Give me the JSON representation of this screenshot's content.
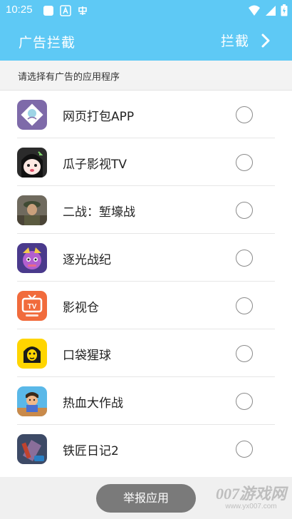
{
  "status_bar": {
    "time": "10:25",
    "background": "#5ec9f5"
  },
  "app_bar": {
    "title": "广告拦截",
    "action_label": "拦截",
    "action_icon": "chevron-right-icon"
  },
  "section": {
    "header": "请选择有广告的应用程序"
  },
  "apps": [
    {
      "name": "网页打包APP",
      "icon": "app-icon-webpack",
      "selected": false
    },
    {
      "name": "瓜子影视TV",
      "icon": "app-icon-guazi",
      "selected": false
    },
    {
      "name": "二战：堑壕战",
      "icon": "app-icon-ww2",
      "selected": false
    },
    {
      "name": "逐光战纪",
      "icon": "app-icon-zhuguang",
      "selected": false
    },
    {
      "name": "影视仓",
      "icon": "app-icon-yingshicang",
      "selected": false
    },
    {
      "name": "口袋猩球",
      "icon": "app-icon-koudai",
      "selected": false
    },
    {
      "name": "热血大作战",
      "icon": "app-icon-rexue",
      "selected": false
    },
    {
      "name": "铁匠日记2",
      "icon": "app-icon-tiejiang",
      "selected": false
    }
  ],
  "bottom": {
    "report_label": "举报应用"
  },
  "watermark": {
    "main": "007游戏网",
    "url": "www.yx007.com"
  }
}
